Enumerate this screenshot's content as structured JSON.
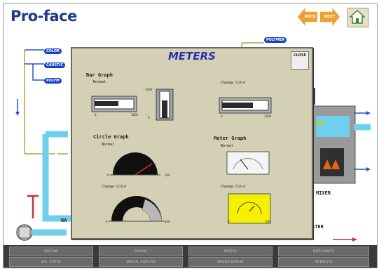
{
  "header": {
    "logo": "Pro-face"
  },
  "nav": {
    "left_label": "BACK",
    "right_label": "NEXT",
    "home_icon": "home-icon"
  },
  "process_tags": {
    "tag1": "COLOR",
    "tag2": "CAUSTIC",
    "tag3": "POLYM",
    "tag4": "POLYMER"
  },
  "process_labels": {
    "mixer": "MIXER",
    "water": "ATER",
    "water_sub": "TANK",
    "ra": "RA"
  },
  "dialog": {
    "title": "METERS",
    "close_label": "CLOSE",
    "bar_graph": {
      "title": "Bar Graph",
      "normal": "Normal",
      "change_color": "Change Color",
      "tick_min": "0",
      "tick_max": "1000"
    },
    "circle_graph": {
      "title": "Circle Graph",
      "normal": "Normal",
      "change_color": "Change Color",
      "tick_min": "0",
      "tick_max": "100"
    },
    "meter_graph": {
      "title": "Meter Graph",
      "normal": "Normal",
      "change_color": "Change Color",
      "tick_min": "0",
      "tick_max": "100"
    }
  },
  "bottom_buttons": [
    "LOGGING",
    "GRAPHS",
    "METERS",
    "DATA SHEETS",
    "SYS. STATUS",
    "SPECIAL DISPLAYS",
    "SPEEDO DISPLAY",
    "INTERLOCK"
  ],
  "colors": {
    "title_blue": "#2a2fb0",
    "tag_blue": "#1a40c8",
    "pipe_cyan": "#6fd0ec",
    "dialog_bg": "#d4d0b6",
    "meter_yellow": "#f4f000"
  }
}
